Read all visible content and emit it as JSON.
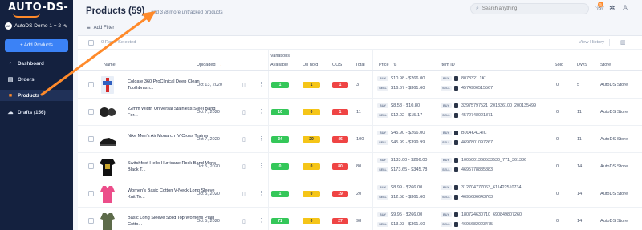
{
  "sidebar": {
    "logo": "AUTO-DS-",
    "store_name": "AutoDS Demo 1 + 2",
    "add_products_label": "+ Add Products",
    "items": [
      {
        "label": "Dashboard",
        "icon": "dashboard-icon"
      },
      {
        "label": "Orders",
        "icon": "orders-icon"
      },
      {
        "label": "Products",
        "icon": "products-icon",
        "active": true
      },
      {
        "label": "Drafts (156)",
        "icon": "drafts-icon"
      }
    ]
  },
  "header": {
    "title": "Products (59)",
    "untracked": "and 378 more untracked products",
    "search_placeholder": "Search anything",
    "notification_count": "5"
  },
  "toolbar": {
    "filter_label": "Add Filter",
    "selected_label": "0 Rows Selected",
    "view_history_label": "View History"
  },
  "table": {
    "variations_label": "Variations",
    "columns": [
      "Name",
      "Uploaded",
      "Available",
      "On hold",
      "OOS",
      "Total",
      "Price",
      "Item ID",
      "Sold",
      "DWS",
      "Store"
    ],
    "rows": [
      {
        "name": "Colgate 360 ProClinical Deep Clean Toothbrush...",
        "uploaded": "Oct 13, 2020",
        "available": "1",
        "on_hold": "1",
        "oos": "1",
        "total": "3",
        "buy": "$10.98 - $266.00",
        "sell": "$16.67 - $361.60",
        "buy_id": "8078321 1K1",
        "sell_id": "4574906515567",
        "sold": "0",
        "dws": "5",
        "store": "AutoDS Store",
        "thumb": "toothbrush"
      },
      {
        "name": "22mm Width Universal Stainless Steel Band For...",
        "uploaded": "Oct 7, 2020",
        "available": "10",
        "on_hold": "0",
        "oos": "1",
        "total": "11",
        "buy": "$8.58 - $10.80",
        "sell": "$12.02 - $15.17",
        "buy_id": "32975797521_201336100_200135499",
        "sell_id": "4572748021871",
        "sold": "0",
        "dws": "11",
        "store": "AutoDS Store",
        "thumb": "watch"
      },
      {
        "name": "Nike Men's Air Monarch IV Cross Trainer",
        "uploaded": "Oct 7, 2020",
        "available": "34",
        "on_hold": "20",
        "oos": "46",
        "total": "100",
        "buy": "$45.90 - $266.00",
        "sell": "$45.99 - $399.99",
        "buy_id": "B004K4C4IC",
        "sell_id": "4697801097267",
        "sold": "0",
        "dws": "11",
        "store": "AutoDS Store",
        "thumb": "shoe"
      },
      {
        "name": "Switchfoot Hello Hurricane Rock Band Mens Black T...",
        "uploaded": "Oct 5, 2020",
        "available": "0",
        "on_hold": "0",
        "oos": "80",
        "total": "80",
        "buy": "$133.00 - $266.00",
        "sell": "$173.65 - $345.78",
        "buy_id": "1005001368533530_771_361386",
        "sell_id": "4695778885883",
        "sold": "0",
        "dws": "14",
        "store": "AutoDS Store",
        "thumb": "tshirt"
      },
      {
        "name": "Women's Basic Cotton V-Neck Long Sleeve Knit To...",
        "uploaded": "Oct 5, 2020",
        "available": "1",
        "on_hold": "0",
        "oos": "19",
        "total": "20",
        "buy": "$8.99 - $266.00",
        "sell": "$12.58 - $361.60",
        "buy_id": "312704777063_611422510734",
        "sell_id": "4695686643763",
        "sold": "0",
        "dws": "14",
        "store": "AutoDS Store",
        "thumb": "pinkshirt"
      },
      {
        "name": "Basic Long Sleeve Solid Top Womens Plain Cotto...",
        "uploaded": "Oct 5, 2020",
        "available": "71",
        "on_hold": "0",
        "oos": "27",
        "total": "98",
        "buy": "$9.95 - $266.00",
        "sell": "$13.93 - $361.60",
        "buy_id": "180724630710_690849807260",
        "sell_id": "4695682023475",
        "sold": "0",
        "dws": "14",
        "store": "AutoDS Store",
        "thumb": "greenshirt"
      }
    ]
  },
  "colors": {
    "sidebar_bg": "#14213f",
    "accent": "#3b82f6",
    "arrow": "#ff8a2a",
    "available": "#34c759",
    "on_hold": "#f5c518",
    "oos": "#ef4444"
  }
}
